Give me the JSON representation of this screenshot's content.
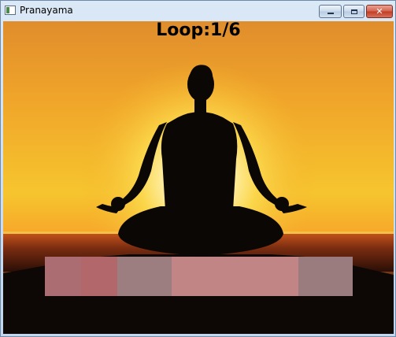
{
  "window": {
    "title": "Pranayama",
    "controls": {
      "close_glyph": "✕"
    }
  },
  "main": {
    "loop_label": "Loop:1/6"
  },
  "progress": {
    "segments": [
      {
        "fraction": 0.118,
        "color": "#ab6c72"
      },
      {
        "fraction": 0.118,
        "color": "#b2676b"
      },
      {
        "fraction": 0.176,
        "color": "#9d7e80"
      },
      {
        "fraction": 0.412,
        "color": "#c18585"
      },
      {
        "fraction": 0.176,
        "color": "#9a7b7e"
      }
    ]
  },
  "icons": {
    "app": "window-app-icon",
    "minimize": "minimize-icon",
    "maximize": "maximize-icon",
    "close": "close-icon",
    "background": "meditation-silhouette-image"
  }
}
